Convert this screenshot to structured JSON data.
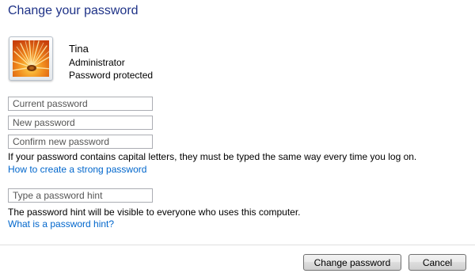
{
  "page": {
    "title": "Change your password"
  },
  "user": {
    "name": "Tina",
    "role": "Administrator",
    "status": "Password protected"
  },
  "form": {
    "current_password_placeholder": "Current password",
    "new_password_placeholder": "New password",
    "confirm_password_placeholder": "Confirm new password",
    "capital_letters_note": "If your password contains capital letters, they must be typed the same way every time you log on.",
    "strong_password_link": "How to create a strong password",
    "hint_placeholder": "Type a password hint",
    "hint_note": "The password hint will be visible to everyone who uses this computer.",
    "hint_link": "What is a password hint?"
  },
  "buttons": {
    "change_password": "Change password",
    "cancel": "Cancel"
  },
  "colors": {
    "title": "#1e3287",
    "link": "#0066cc"
  },
  "icons": {
    "avatar": "orange-flower-picture"
  }
}
